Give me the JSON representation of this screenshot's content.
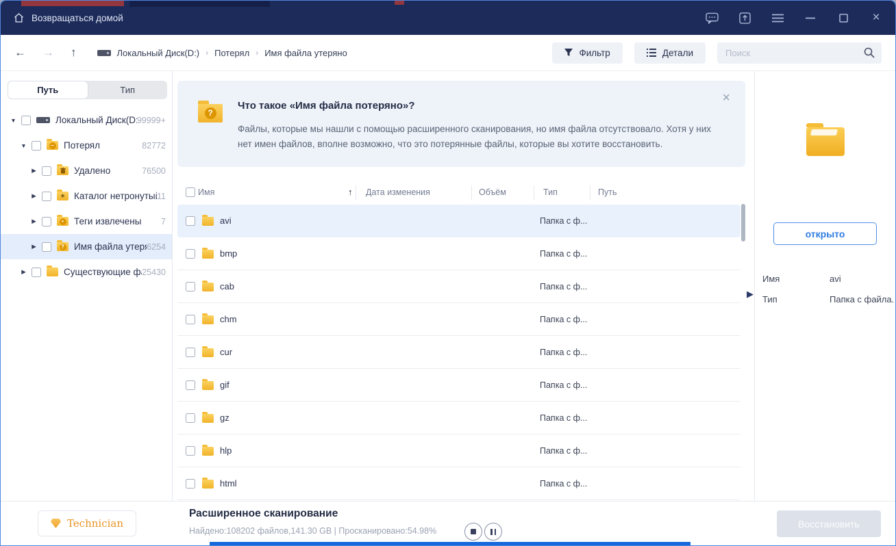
{
  "titlebar": {
    "home_label": "Возвращаться домой",
    "icons": [
      "home-icon",
      "feedback-bubble-icon",
      "upgrade-icon",
      "menu-icon",
      "minimize-icon",
      "maximize-icon",
      "close-icon"
    ]
  },
  "toolbar": {
    "breadcrumb": [
      "Локальный Диск(D:)",
      "Потерял",
      "Имя файла утеряно"
    ],
    "breadcrumb_separator": "›",
    "filter_label": "Фильтр",
    "details_label": "Детали",
    "search_placeholder": "Поиск"
  },
  "sidebar": {
    "tabs": [
      {
        "label": "Путь",
        "active": true
      },
      {
        "label": "Тип",
        "active": false
      }
    ],
    "tree": [
      {
        "label": "Локальный Диск(D:)",
        "count": "99999+",
        "level": 0,
        "icon": "disk",
        "arrow": "down",
        "selected": false
      },
      {
        "label": "Потерял",
        "count": "82772",
        "level": 1,
        "icon": "folder-minus",
        "arrow": "down",
        "selected": false
      },
      {
        "label": "Удалено",
        "count": "76500",
        "level": 2,
        "icon": "folder-trash",
        "arrow": "right",
        "selected": false
      },
      {
        "label": "Каталог нетронутый",
        "count": "11",
        "level": 2,
        "icon": "folder-star",
        "arrow": "right",
        "selected": false
      },
      {
        "label": "Теги извлечены",
        "count": "7",
        "level": 2,
        "icon": "folder-tag",
        "arrow": "right",
        "selected": false
      },
      {
        "label": "Имя файла утеряно",
        "count": "6254",
        "level": 2,
        "icon": "folder-question",
        "arrow": "right",
        "selected": true
      },
      {
        "label": "Существующие фа...",
        "count": "25430",
        "level": 1,
        "icon": "folder",
        "arrow": "right",
        "selected": false
      }
    ]
  },
  "banner": {
    "title": "Что такое «Имя файла потеряно»?",
    "body": "Файлы, которые мы нашли с помощью расширенного сканирования, но имя файла отсутствовало. Хотя у них нет имен файлов, вполне возможно, что это потерянные файлы, которые вы хотите восстановить.",
    "close_icon": "×"
  },
  "table": {
    "columns": [
      {
        "label": "Имя"
      },
      {
        "label": "Дата изменения"
      },
      {
        "label": "Объём"
      },
      {
        "label": "Тип"
      },
      {
        "label": "Путь"
      }
    ],
    "sort_arrow": "↑",
    "rows": [
      {
        "name": "avi",
        "type": "Папка с ф...",
        "selected": true
      },
      {
        "name": "bmp",
        "type": "Папка с ф...",
        "selected": false
      },
      {
        "name": "cab",
        "type": "Папка с ф...",
        "selected": false
      },
      {
        "name": "chm",
        "type": "Папка с ф...",
        "selected": false
      },
      {
        "name": "cur",
        "type": "Папка с ф...",
        "selected": false
      },
      {
        "name": "gif",
        "type": "Папка с ф...",
        "selected": false
      },
      {
        "name": "gz",
        "type": "Папка с ф...",
        "selected": false
      },
      {
        "name": "hlp",
        "type": "Папка с ф...",
        "selected": false
      },
      {
        "name": "html",
        "type": "Папка с ф...",
        "selected": false
      }
    ]
  },
  "preview": {
    "open_label": "открыто",
    "props": [
      {
        "label": "Имя",
        "value": "avi"
      },
      {
        "label": "Тип",
        "value": "Папка с файла.."
      }
    ]
  },
  "statusbar": {
    "license_label": "Technician",
    "scan_title": "Расширенное сканирование",
    "scan_stats": "Найдено:108202 файлов,141.30 GB | Просканировано:54.98%",
    "recover_label": "Восстановить",
    "progress_percent": 54.98
  },
  "colors": {
    "titlebar_navy": "#1d2b5a",
    "accent_blue": "#2e7ce0",
    "progress_blue": "#1668dc",
    "folder_yellow": "#f3b92e",
    "selected_row_bg": "#e9f1fd",
    "banner_bg": "#eef3fa"
  }
}
